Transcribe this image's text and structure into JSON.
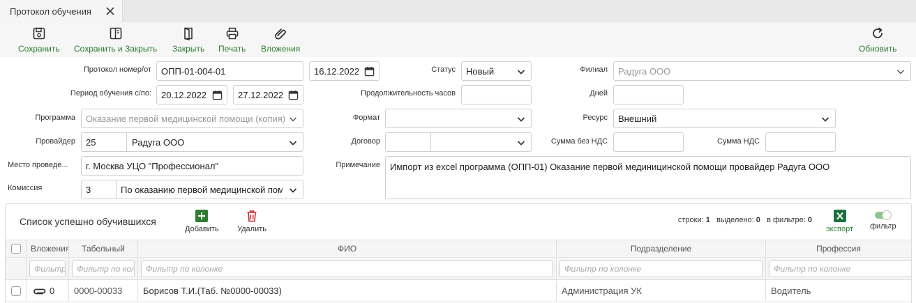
{
  "tab": {
    "title": "Протокол обучения"
  },
  "toolbar": {
    "save": "Сохранить",
    "save_close": "Сохранить и Закрыть",
    "close": "Закрыть",
    "print": "Печать",
    "attachments": "Вложения",
    "refresh": "Обновить"
  },
  "form": {
    "protocol_label": "Протокол номер/от",
    "protocol_number": "ОПП-01-004-01",
    "protocol_date": "16.12.2022",
    "status_label": "Статус",
    "status_value": "Новый",
    "branch_label": "Филиал",
    "branch_value": "Радуга ООО",
    "period_label": "Период обучения с/по:",
    "period_from": "20.12.2022",
    "period_to": "27.12.2022",
    "duration_label": "Продолжительность часов",
    "duration_value": "",
    "days_label": "Дней",
    "days_value": "",
    "program_label": "Программа",
    "program_value": "Оказание первой медицинской помощи (копия)",
    "format_label": "Формат",
    "format_value": "",
    "resource_label": "Ресурс",
    "resource_value": "Внешний",
    "provider_label": "Провайдер",
    "provider_code": "25",
    "provider_name": "Радуга ООО",
    "contract_label": "Договор",
    "contract_code": "",
    "contract_name": "",
    "sum_novat_label": "Сумма без НДС",
    "sum_novat_value": "",
    "sum_vat_label": "Сумма НДС",
    "sum_vat_value": "",
    "place_label": "Место проведе...",
    "place_value": "г. Москва УЦО \"Профессионал\"",
    "note_label": "Примечание",
    "note_value": "Импорт из excel программа (ОПП-01) Оказание первой мединицинской помощи провайдер Радуга ООО",
    "commission_label": "Комиссия",
    "commission_code": "3",
    "commission_name": "По оказанию первой медицинской помощи"
  },
  "grid": {
    "title": "Список успешно обучившихся",
    "add": "Добавить",
    "delete": "Удалить",
    "rows_label": "строки:",
    "rows_value": "1",
    "selected_label": "выделено:",
    "selected_value": "0",
    "filtered_label": "в фильтре:",
    "filtered_value": "0",
    "export": "экспорт",
    "filter": "фильтр",
    "columns": {
      "attachments": "Вложения",
      "tab_no": "Табельный",
      "fio": "ФИО",
      "department": "Подразделение",
      "profession": "Профессия"
    },
    "filter_placeholders": {
      "attachments": "Фильтр",
      "tab_no": "Фильтр по колонке",
      "fio": "Фильтр по колонке",
      "department": "Фильтр по колонке",
      "profession": "Фильтр по колонке"
    },
    "rows": [
      {
        "attachments": "0",
        "tab_no": "0000-00033",
        "fio": "Борисов Т.И.(Таб. №0000-00033)",
        "department": "Администрация УК",
        "profession": "Водитель"
      }
    ]
  },
  "colors": {
    "accent": "#2e7d32",
    "danger": "#c62828",
    "excel": "#1d6f42"
  }
}
